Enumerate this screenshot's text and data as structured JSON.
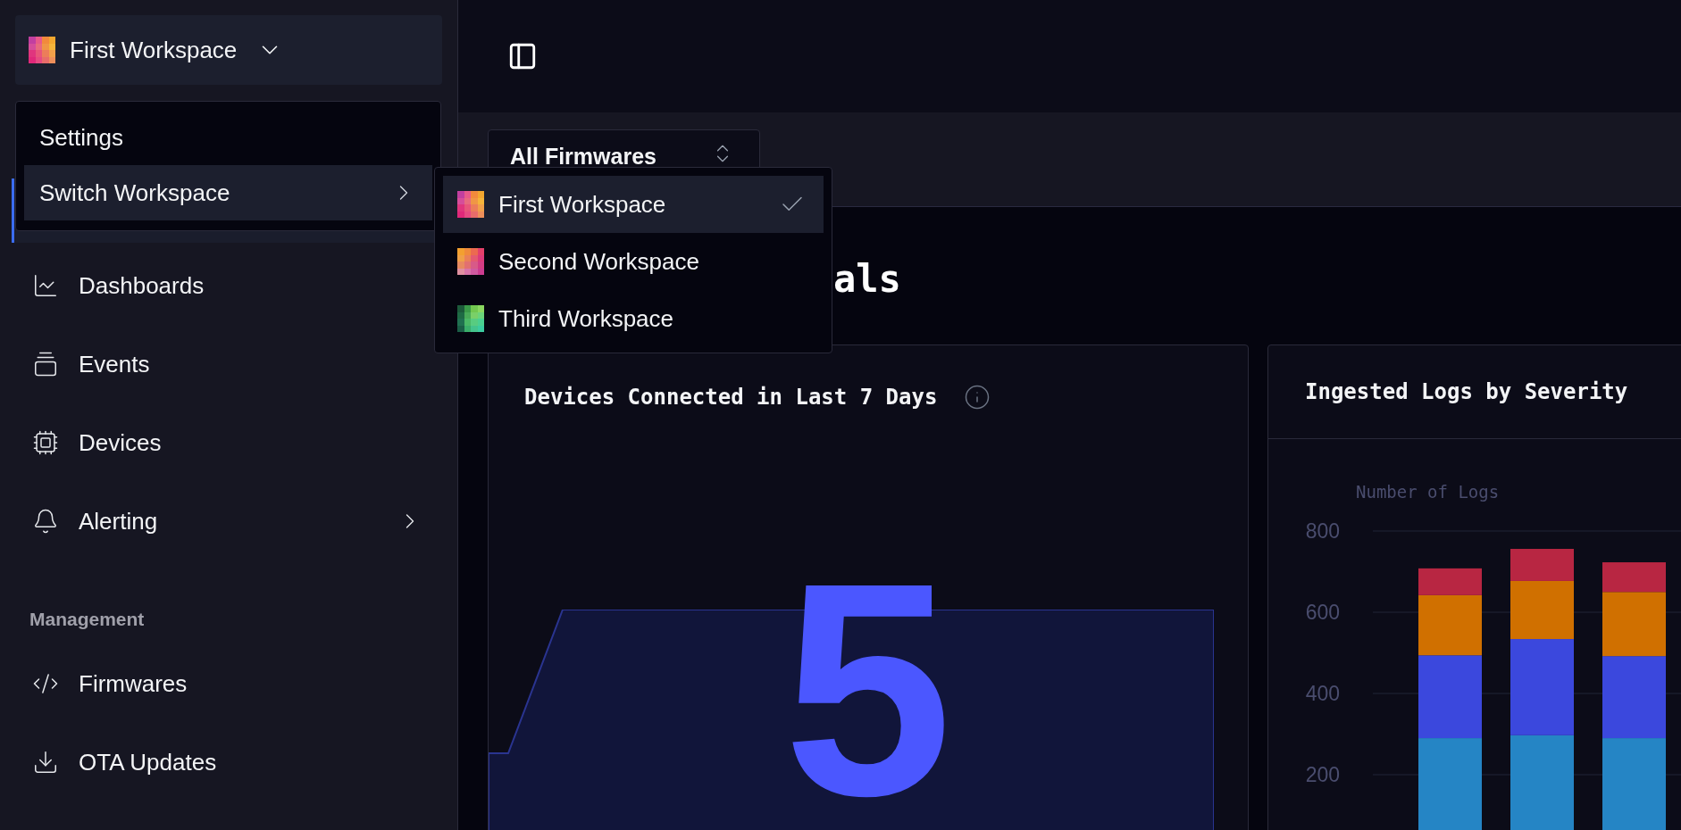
{
  "workspace_button": {
    "label": "First Workspace"
  },
  "workspace_menu": {
    "items": [
      {
        "label": "Settings",
        "kind": "plain",
        "selected": false
      },
      {
        "label": "Switch Workspace",
        "kind": "submenu",
        "selected": true
      }
    ]
  },
  "workspace_submenu": {
    "items": [
      {
        "label": "First Workspace",
        "selected": true
      },
      {
        "label": "Second Workspace",
        "selected": false
      },
      {
        "label": "Third Workspace",
        "selected": false
      }
    ]
  },
  "sidebar": {
    "items": [
      {
        "label": "Dashboards",
        "has_submenu": false
      },
      {
        "label": "Events",
        "has_submenu": false
      },
      {
        "label": "Devices",
        "has_submenu": false
      },
      {
        "label": "Alerting",
        "has_submenu": true
      }
    ],
    "sections": [
      {
        "title": "Management",
        "items": [
          {
            "label": "Firmwares",
            "has_submenu": false
          },
          {
            "label": "OTA Updates",
            "has_submenu": false
          }
        ]
      }
    ]
  },
  "filter": {
    "value": "All Firmwares"
  },
  "page_heading": "als",
  "cards": [
    {
      "title": "Devices Connected in Last 7 Days",
      "value": "5"
    },
    {
      "title": "Ingested Logs by Severity",
      "chart_data": {
        "type": "bar",
        "stacked": true,
        "ylabel": "Number of Logs",
        "yticks": [
          200,
          400,
          600,
          800
        ],
        "ylim": [
          0,
          800
        ],
        "grid": true,
        "series": [
          {
            "color": "#2585c5",
            "values": [
              290,
              297,
              290
            ]
          },
          {
            "color": "#3b48dd",
            "values": [
              204,
              237,
              202
            ]
          },
          {
            "color": "#d07000",
            "values": [
              148,
              143,
              158
            ]
          },
          {
            "color": "#b82642",
            "values": [
              66,
              79,
              73
            ]
          }
        ]
      }
    }
  ]
}
